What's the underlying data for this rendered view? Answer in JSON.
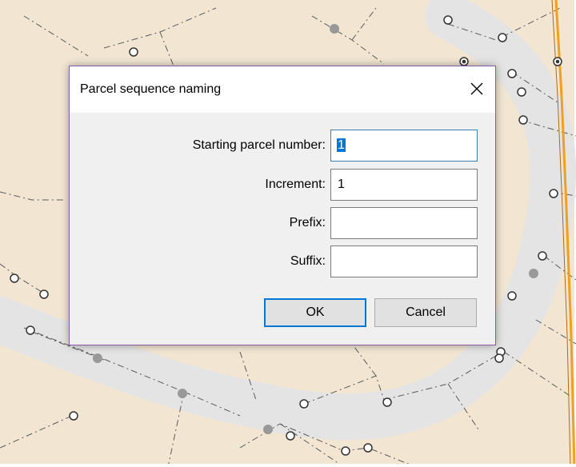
{
  "dialog": {
    "title": "Parcel sequence naming",
    "close_icon": "close-icon",
    "fields": {
      "starting_label": "Starting parcel number:",
      "starting_value": "1",
      "increment_label": "Increment:",
      "increment_value": "1",
      "prefix_label": "Prefix:",
      "prefix_value": "",
      "suffix_label": "Suffix:",
      "suffix_value": ""
    },
    "buttons": {
      "ok_label": "OK",
      "cancel_label": "Cancel"
    }
  },
  "colors": {
    "map_background": "#f2e6d3",
    "road": "#e4e4e4",
    "parcel_line": "#5a5a5a",
    "boundary_line": "#f0a020",
    "dialog_border": "#8a5aa6",
    "accent": "#0078d7"
  }
}
